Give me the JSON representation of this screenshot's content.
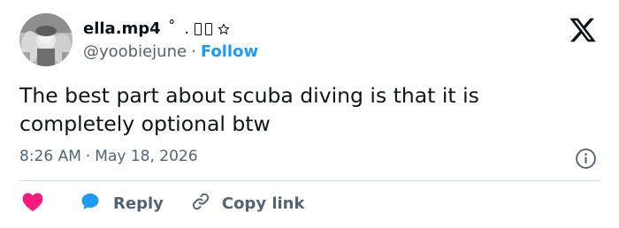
{
  "author": {
    "display_name": "ella.mp4",
    "name_decoration": "˚ .",
    "handle": "@yoobiejune",
    "separator": "·",
    "follow_label": "Follow"
  },
  "tweet": {
    "text": "The best part about scuba diving is that it is completely optional btw",
    "time": "8:26 AM",
    "meta_separator": "·",
    "date": "May 18, 2026"
  },
  "actions": {
    "reply_label": "Reply",
    "copy_link_label": "Copy link"
  },
  "icons": {
    "brand": "x-logo-icon",
    "info": "info-icon",
    "like": "heart-icon",
    "reply": "speech-bubble-icon",
    "copy_link": "link-icon",
    "decoration": "star-outline-icon"
  },
  "colors": {
    "follow_blue": "#1d9bf0",
    "heart_red": "#f91880",
    "bubble_blue": "#1d9bf0",
    "muted_text": "#536471",
    "text": "#0f1419",
    "divider": "#cfd9de"
  }
}
